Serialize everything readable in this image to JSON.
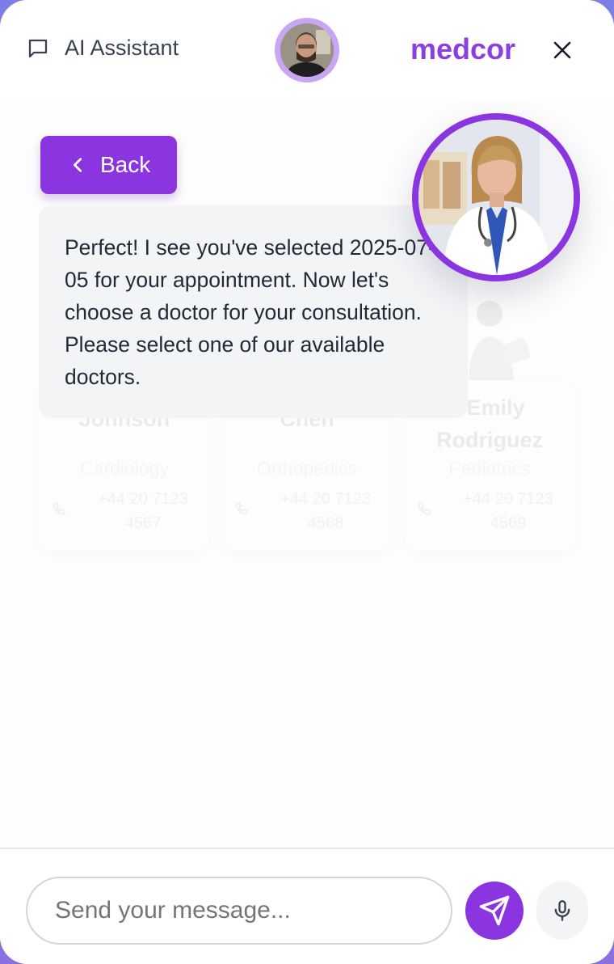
{
  "header": {
    "title": "AI Assistant",
    "brand": "medcor",
    "icons": {
      "chat": "message-square-icon",
      "close": "close-icon"
    }
  },
  "chat": {
    "back_label": "Back",
    "message": "Perfect! I see you've selected 2025-07-05 for your appointment. Now let's choose a doctor for your consultation. Please select one of our available doctors.",
    "doctors": [
      {
        "name": "Johnson",
        "specialty": "Cardiology",
        "phone": "+44 20 7123 4567"
      },
      {
        "name": "Chen",
        "specialty": "Orthopedics",
        "phone": "+44 20 7123 4568"
      },
      {
        "name": ". Emily Rodriguez",
        "specialty": "Pediatrics",
        "phone": "+44 20 7123 4569"
      }
    ]
  },
  "composer": {
    "placeholder": "Send your message...",
    "icons": {
      "send": "send-icon",
      "mic": "microphone-icon"
    }
  },
  "colors": {
    "accent": "#8b35e0",
    "brand": "#8b3fe0",
    "bubble": "#f3f4f6"
  }
}
